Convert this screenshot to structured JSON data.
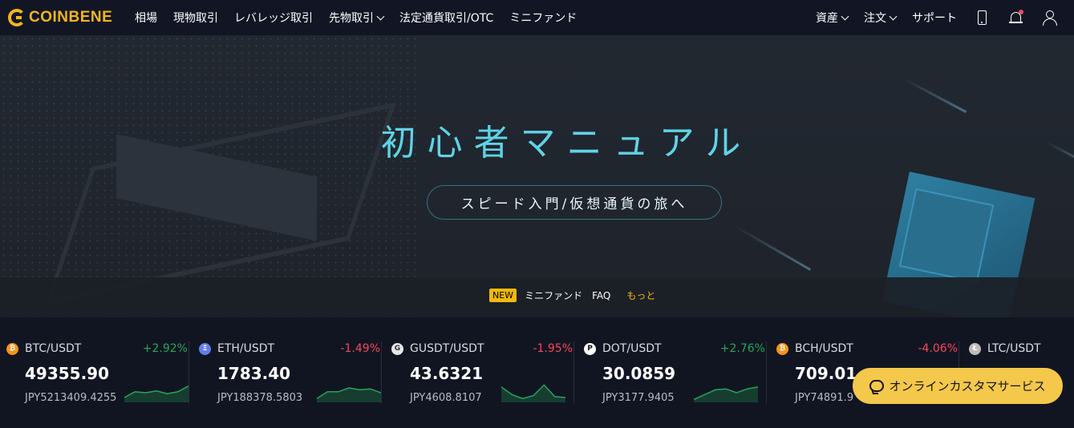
{
  "brand": {
    "name": "COINBENE"
  },
  "nav": {
    "left": [
      {
        "label": "相場",
        "dropdown": false
      },
      {
        "label": "現物取引",
        "dropdown": false
      },
      {
        "label": "レバレッジ取引",
        "dropdown": false
      },
      {
        "label": "先物取引",
        "dropdown": true
      },
      {
        "label": "法定通貨取引/OTC",
        "dropdown": false
      },
      {
        "label": "ミニファンド",
        "dropdown": false
      }
    ],
    "right": [
      {
        "label": "資産",
        "dropdown": true
      },
      {
        "label": "注文",
        "dropdown": true
      },
      {
        "label": "サポート",
        "dropdown": false
      }
    ],
    "icons": [
      "phone-icon",
      "bell-icon",
      "user-icon"
    ]
  },
  "hero": {
    "title": "初心者マニュアル",
    "cta": "スピード入門/仮想通貨の旅へ"
  },
  "news": {
    "badge": "NEW",
    "item1": "ミニファンド",
    "item2": "FAQ",
    "more": "もっと"
  },
  "tickers": [
    {
      "pair": "BTC/USDT",
      "change": "+2.92%",
      "direction": "up",
      "price": "49355.90",
      "jpy": "JPY5213409.4255",
      "coin_color": "#f7931a",
      "coin_glyph": "₿",
      "spark": [
        0.25,
        0.55,
        0.5,
        0.6,
        0.45,
        0.55,
        0.85
      ]
    },
    {
      "pair": "ETH/USDT",
      "change": "-1.49%",
      "direction": "down",
      "price": "1783.40",
      "jpy": "JPY188378.5803",
      "coin_color": "#627eea",
      "coin_glyph": "Ξ",
      "spark": [
        0.2,
        0.55,
        0.55,
        0.75,
        0.65,
        0.7,
        0.5
      ]
    },
    {
      "pair": "GUSDT/USDT",
      "change": "-1.95%",
      "direction": "down",
      "price": "43.6321",
      "jpy": "JPY4608.8107",
      "coin_color": "#e8e8e8",
      "coin_glyph": "G",
      "spark": [
        0.8,
        0.4,
        0.2,
        0.35,
        0.9,
        0.3,
        0.25
      ]
    },
    {
      "pair": "DOT/USDT",
      "change": "+2.76%",
      "direction": "up",
      "price": "30.0859",
      "jpy": "JPY3177.9405",
      "coin_color": "#e6007a",
      "coin_glyph": "P",
      "spark": [
        0.15,
        0.4,
        0.65,
        0.7,
        0.5,
        0.7,
        0.8
      ]
    },
    {
      "pair": "BCH/USDT",
      "change": "-4.06%",
      "direction": "down",
      "price": "709.01",
      "jpy": "JPY74891.9",
      "coin_color": "#f7931a",
      "coin_glyph": "₿",
      "spark": []
    },
    {
      "pair": "LTC/USDT",
      "change": "",
      "direction": "up",
      "price": "",
      "jpy": "",
      "coin_color": "#bfbbbb",
      "coin_glyph": "Ł",
      "spark": []
    }
  ],
  "chat": {
    "label": "オンラインカスタマサービス"
  },
  "colors": {
    "accent": "#f0b90b",
    "up": "#26a55c",
    "down": "#f6465d",
    "title": "#5fd3e6"
  }
}
